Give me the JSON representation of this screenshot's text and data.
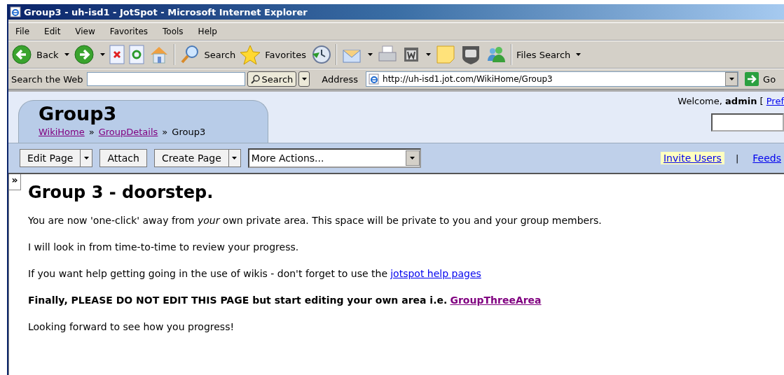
{
  "window": {
    "title": "Group3 - uh-isd1 - JotSpot - Microsoft Internet Explorer"
  },
  "menu": [
    "File",
    "Edit",
    "View",
    "Favorites",
    "Tools",
    "Help"
  ],
  "toolbar": [
    {
      "kind": "back",
      "label": "Back",
      "dropdown": true
    },
    {
      "kind": "forward",
      "dropdown": true
    },
    {
      "kind": "stop"
    },
    {
      "kind": "refresh"
    },
    {
      "kind": "home"
    },
    {
      "kind": "sep"
    },
    {
      "kind": "search",
      "label": "Search"
    },
    {
      "kind": "favorites",
      "label": "Favorites"
    },
    {
      "kind": "history"
    },
    {
      "kind": "sep"
    },
    {
      "kind": "mail",
      "dropdown": true
    },
    {
      "kind": "print"
    },
    {
      "kind": "word",
      "dropdown": true
    },
    {
      "kind": "note"
    },
    {
      "kind": "shield"
    },
    {
      "kind": "messenger"
    },
    {
      "kind": "sep"
    },
    {
      "kind": "text",
      "label": "Files Search",
      "dropdown": true
    }
  ],
  "search_bar": {
    "label": "Search the Web",
    "button": "Search"
  },
  "address_bar": {
    "label": "Address",
    "value": "http://uh-isd1.jot.com/WikiHome/Group3",
    "go": "Go"
  },
  "page": {
    "title": "Group3",
    "breadcrumbs": [
      {
        "label": "WikiHome",
        "link": true
      },
      {
        "label": "GroupDetails",
        "link": true
      },
      {
        "label": "Group3",
        "link": false
      }
    ],
    "separator": "»",
    "welcome": "Welcome, **admin** [",
    "pref_link": "Pref",
    "actions": [
      {
        "label": "Edit Page",
        "dropdown": true
      },
      {
        "label": "Attach",
        "dropdown": false
      },
      {
        "label": "Create Page",
        "dropdown": true
      }
    ],
    "more_actions": "More Actions...",
    "right_links": [
      {
        "label": "Invite Users",
        "highlighted": true
      },
      {
        "label": "Feeds",
        "highlighted": false
      }
    ],
    "link_separator": "|",
    "toggle": "»",
    "heading": "Group 3 - doorstep.",
    "paragraphs": [
      {
        "text": "You are now 'one-click' away from *your* own private area. This space will be private to you and your group members.",
        "bold": false
      },
      {
        "text": "I will look in from time-to-time to review your progress.",
        "bold": false
      },
      {
        "text": "If you want help getting going in the use of wikis - don't forget to use the",
        "bold": false,
        "link": "jotspot help pages",
        "visited": false
      },
      {
        "text": "Finally, PLEASE DO NOT EDIT THIS PAGE but start editing your own area i.e.",
        "bold": true,
        "link": "GroupThreeArea",
        "visited": true
      },
      {
        "text": "Looking forward to see how you progress!",
        "bold": false
      }
    ]
  }
}
